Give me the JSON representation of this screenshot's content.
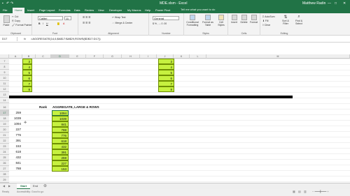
{
  "titlebar": {
    "doc_title": "MDE.xlsm - Excel",
    "user": "Matthew Radin",
    "qat_icons": [
      "save-icon",
      "undo-icon",
      "redo-icon"
    ]
  },
  "tabs": [
    "File",
    "Home",
    "Insert",
    "Page Layout",
    "Formulas",
    "Data",
    "Review",
    "View",
    "Developer",
    "My Macros",
    "Help",
    "Power Pivot"
  ],
  "tell_me": "Tell me what you want to do",
  "ribbon": {
    "clipboard": {
      "paste": "Paste",
      "cut": "Cut",
      "copy": "Copy",
      "format_painter": "Format Painter",
      "label": "Clipboard"
    },
    "font": {
      "name": "Calibri",
      "size": "11",
      "label": "Font"
    },
    "alignment": {
      "wrap": "Wrap Text",
      "merge": "Merge & Center",
      "label": "Alignment"
    },
    "number": {
      "format": "General",
      "label": "Number"
    },
    "styles": {
      "cond": "Conditional Formatting",
      "table": "Format as Table",
      "cell": "Cell Styles",
      "label": "Styles"
    },
    "cells": {
      "insert": "Insert",
      "delete": "Delete",
      "format": "Format",
      "label": "Cells"
    },
    "editing": {
      "autosum": "AutoSum",
      "fill": "Fill",
      "clear": "Clear",
      "sort": "Sort & Filter",
      "find": "Find & Select",
      "label": "Editing"
    }
  },
  "formula_bar": {
    "name_box": "D17",
    "fx": "fx",
    "formula": "=AGGREGATE(14,6,$A$17:$A$29,ROWS($D$17:D17))"
  },
  "columns": [
    "A",
    "B",
    "C",
    "D",
    "E",
    "F",
    "G",
    "H",
    "I",
    "J",
    "K",
    "L",
    "M"
  ],
  "top_rows": [
    "7",
    "8",
    "9",
    "10",
    "11",
    "12",
    "13",
    "14",
    "15"
  ],
  "top_values_left": [
    3,
    4,
    5,
    6,
    7,
    8
  ],
  "top_values_right": [
    3,
    4,
    5,
    6,
    7,
    8
  ],
  "bottom_rows": [
    "16",
    "17",
    "18",
    "19",
    "20",
    "21",
    "22",
    "23",
    "24",
    "25",
    "26",
    "27",
    "28",
    "29"
  ],
  "rank_label": "Rank",
  "header_label": "AGGREGATE, LARGE & ROWS",
  "a_values": [
    259,
    1039,
    1094,
    227,
    776,
    391,
    153,
    618,
    432,
    841,
    788
  ],
  "d_values": [
    1094,
    1039,
    841,
    788,
    776,
    618,
    432,
    391,
    259,
    227,
    153
  ],
  "sheets": [
    "Start",
    "End"
  ],
  "status": {
    "ready": "Ready",
    "accessibility": "Accessibility: Good to go"
  }
}
